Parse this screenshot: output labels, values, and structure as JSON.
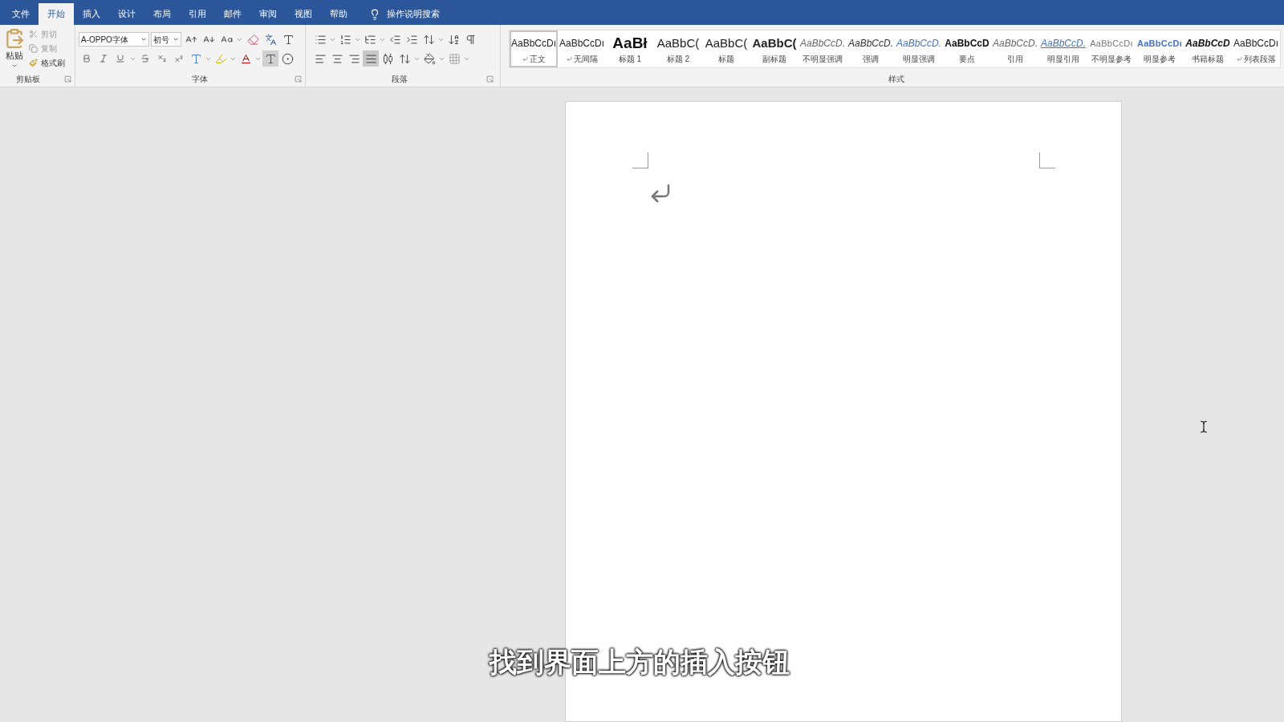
{
  "menu_tabs": [
    {
      "label": "文件",
      "selected": false
    },
    {
      "label": "开始",
      "selected": true
    },
    {
      "label": "插入",
      "selected": false
    },
    {
      "label": "设计",
      "selected": false
    },
    {
      "label": "布局",
      "selected": false
    },
    {
      "label": "引用",
      "selected": false
    },
    {
      "label": "邮件",
      "selected": false
    },
    {
      "label": "审阅",
      "selected": false
    },
    {
      "label": "视图",
      "selected": false
    },
    {
      "label": "帮助",
      "selected": false
    }
  ],
  "tell_me": {
    "placeholder": "操作说明搜索"
  },
  "clipboard": {
    "paste": "粘贴",
    "cut": "剪切",
    "copy": "复制",
    "format_painter": "格式刷",
    "group_label": "剪贴板"
  },
  "font": {
    "font_name": "A-OPPO字体",
    "font_size": "初号",
    "group_label": "字体"
  },
  "paragraph": {
    "group_label": "段落"
  },
  "styles": {
    "group_label": "样式",
    "items": [
      {
        "preview": "AaBbCcDı",
        "label": "正文",
        "kind": "normal",
        "paragraph_mark": true,
        "selected": true
      },
      {
        "preview": "AaBbCcDı",
        "label": "无间隔",
        "kind": "normal",
        "paragraph_mark": true,
        "selected": false
      },
      {
        "preview": "AaBł",
        "label": "标题 1",
        "kind": "heading1",
        "paragraph_mark": false,
        "selected": false
      },
      {
        "preview": "AaBbC(",
        "label": "标题 2",
        "kind": "heading",
        "paragraph_mark": false,
        "selected": false
      },
      {
        "preview": "AaBbC(",
        "label": "标题",
        "kind": "heading",
        "paragraph_mark": false,
        "selected": false
      },
      {
        "preview": "AaBbC(",
        "label": "副标题",
        "kind": "heading-bold",
        "paragraph_mark": false,
        "selected": false
      },
      {
        "preview": "AaBbCcD.",
        "label": "不明显强调",
        "kind": "italic-grey",
        "paragraph_mark": false,
        "selected": false
      },
      {
        "preview": "AaBbCcD.",
        "label": "强调",
        "kind": "italic",
        "paragraph_mark": false,
        "selected": false
      },
      {
        "preview": "AaBbCcD.",
        "label": "明显强调",
        "kind": "italic-blue",
        "paragraph_mark": false,
        "selected": false
      },
      {
        "preview": "AaBbCcD",
        "label": "要点",
        "kind": "bold",
        "paragraph_mark": false,
        "selected": false
      },
      {
        "preview": "AaBbCcD.",
        "label": "引用",
        "kind": "italic-grey",
        "paragraph_mark": false,
        "selected": false
      },
      {
        "preview": "AaBbCcD.",
        "label": "明显引用",
        "kind": "underline-blue",
        "paragraph_mark": false,
        "selected": false
      },
      {
        "preview": "AaBbCcDı",
        "label": "不明显参考",
        "kind": "caps-grey",
        "paragraph_mark": false,
        "selected": false
      },
      {
        "preview": "AaBbCcDı",
        "label": "明显参考",
        "kind": "caps-blue",
        "paragraph_mark": false,
        "selected": false
      },
      {
        "preview": "AaBbCcD",
        "label": "书籍标题",
        "kind": "bold-italic",
        "paragraph_mark": false,
        "selected": false
      },
      {
        "preview": "AaBbCcDı",
        "label": "列表段落",
        "kind": "normal",
        "paragraph_mark": true,
        "selected": false
      }
    ]
  },
  "caption": "找到界面上方的插入按钮"
}
